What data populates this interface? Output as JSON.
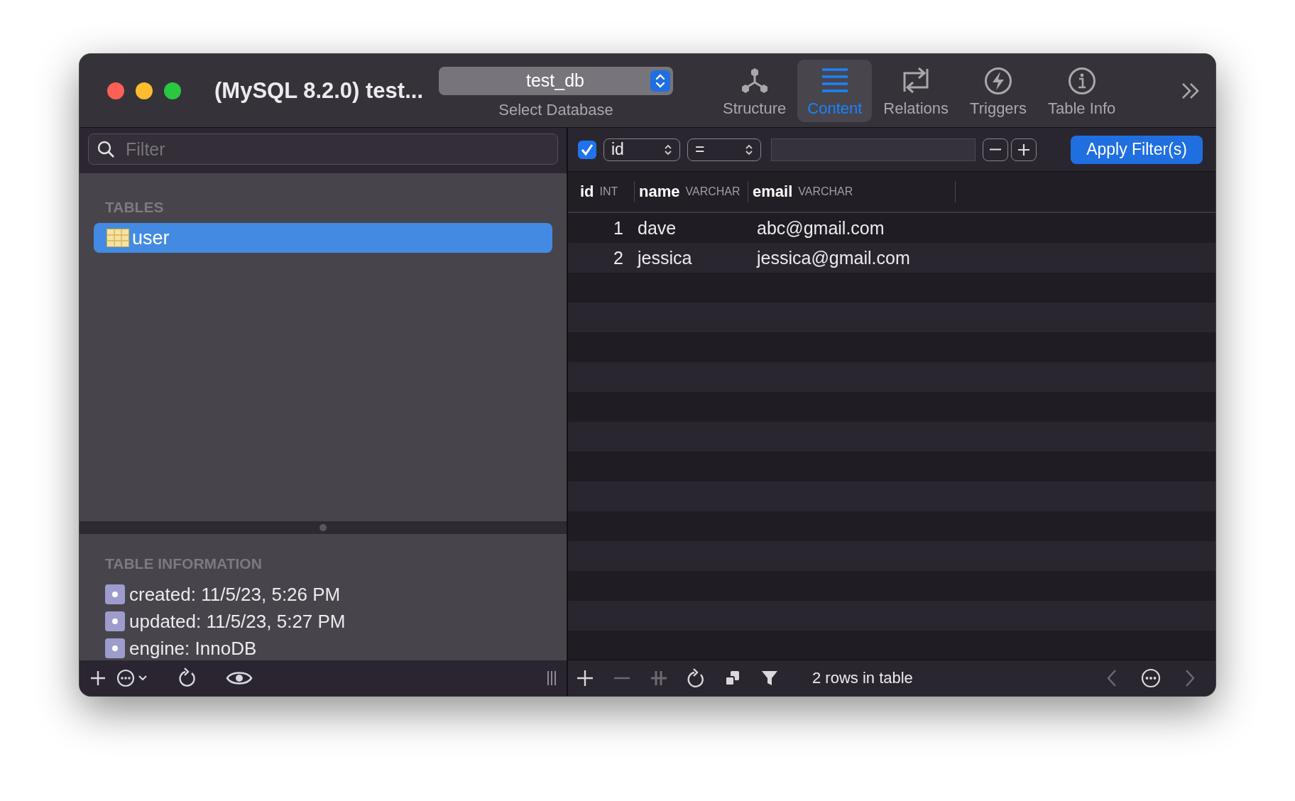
{
  "window": {
    "title": "(MySQL 8.2.0) test..."
  },
  "database_selector": {
    "value": "test_db",
    "label": "Select Database"
  },
  "toolbar": {
    "tabs": [
      {
        "label": "Structure",
        "kind": "structure",
        "selected": false
      },
      {
        "label": "Content",
        "kind": "content",
        "selected": true
      },
      {
        "label": "Relations",
        "kind": "relations",
        "selected": false
      },
      {
        "label": "Triggers",
        "kind": "triggers",
        "selected": false
      },
      {
        "label": "Table Info",
        "kind": "info",
        "selected": false
      }
    ]
  },
  "sidebar": {
    "filter": {
      "placeholder": "Filter"
    },
    "tables_heading": "TABLES",
    "tables": [
      {
        "name": "user",
        "selected": true
      }
    ],
    "info_heading": "TABLE INFORMATION",
    "info": [
      "created: 11/5/23, 5:26 PM",
      "updated: 11/5/23, 5:27 PM",
      "engine: InnoDB"
    ],
    "bottom_buttons": [
      {
        "kind": "add"
      },
      {
        "kind": "more"
      },
      {
        "kind": "refresh"
      },
      {
        "kind": "eye"
      }
    ]
  },
  "filter_bar": {
    "enabled": true,
    "column": "id",
    "operator": "=",
    "apply_button": "Apply Filter(s)"
  },
  "table": {
    "columns": [
      {
        "name": "id",
        "type": "INT"
      },
      {
        "name": "name",
        "type": "VARCHAR"
      },
      {
        "name": "email",
        "type": "VARCHAR"
      }
    ],
    "rows": [
      [
        "1",
        "dave",
        "abc@gmail.com"
      ],
      [
        "2",
        "jessica",
        "jessica@gmail.com"
      ]
    ]
  },
  "status_bar": {
    "text": "2 rows in table",
    "buttons": [
      {
        "kind": "add",
        "disabled": false
      },
      {
        "kind": "remove",
        "disabled": true
      },
      {
        "kind": "duplicate",
        "disabled": true
      },
      {
        "kind": "refresh",
        "disabled": false
      },
      {
        "kind": "copy",
        "disabled": false
      },
      {
        "kind": "filter",
        "disabled": false
      }
    ],
    "pager": [
      {
        "kind": "prev",
        "disabled": true
      },
      {
        "kind": "more",
        "disabled": false
      },
      {
        "kind": "next",
        "disabled": true
      }
    ]
  }
}
